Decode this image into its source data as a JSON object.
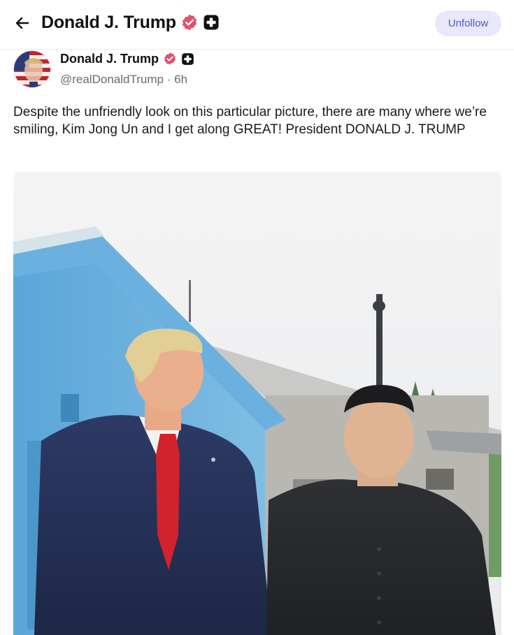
{
  "header": {
    "title": "Donald J. Trump",
    "unfollow_label": "Unfollow"
  },
  "post": {
    "author_name": "Donald J. Trump",
    "handle": "@realDonaldTrump",
    "separator": "·",
    "time": "6h",
    "text": "Despite the unfriendly look on this particular picture, there are many where we’re smiling, Kim Jong Un and I get along GREAT! President DONALD J. TRUMP"
  },
  "icons": {
    "back": "arrow-left-icon",
    "verified": "verified-badge-icon",
    "plus": "plus-badge-icon"
  },
  "colors": {
    "verified_badge": "#e2506b",
    "unfollow_bg": "#e8e8fa",
    "unfollow_text": "#4a5bd3"
  }
}
